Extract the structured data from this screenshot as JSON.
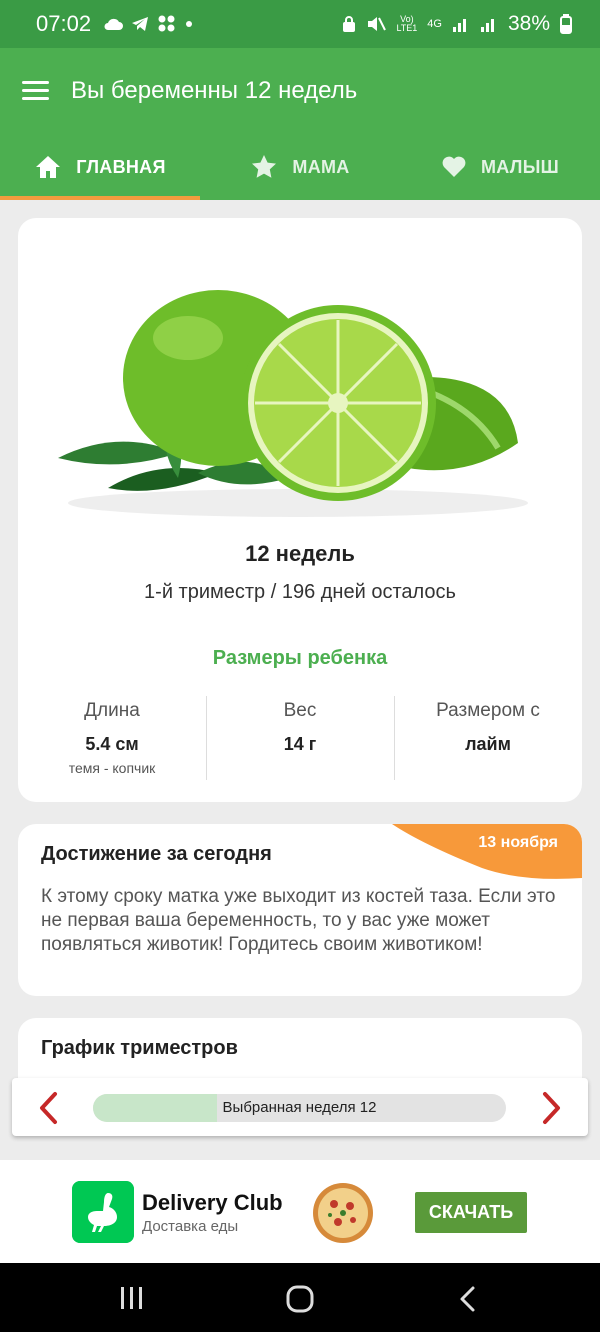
{
  "status": {
    "time": "07:02",
    "network": "4G",
    "battery": "38%"
  },
  "appbar": {
    "title": "Вы беременны 12 недель"
  },
  "tabs": [
    {
      "label": "ГЛАВНАЯ",
      "icon": "home-icon",
      "active": true
    },
    {
      "label": "МАМА",
      "icon": "star-icon",
      "active": false
    },
    {
      "label": "МАЛЫШ",
      "icon": "heart-icon",
      "active": false
    }
  ],
  "main": {
    "image": "lime-image",
    "week_title": "12 недель",
    "trimester": "1-й триместр / 196 дней осталось",
    "sizes_title": "Размеры ребенка",
    "metrics": [
      {
        "label": "Длина",
        "value": "5.4 см",
        "sub": "темя - копчик"
      },
      {
        "label": "Вес",
        "value": "14 г",
        "sub": ""
      },
      {
        "label": "Размером с",
        "value": "лайм",
        "sub": ""
      }
    ]
  },
  "achievement": {
    "title": "Достижение за сегодня",
    "date": "13 ноября",
    "text": "К этому сроку матка уже выходит из костей таза. Если это не первая ваша беременность, то у вас уже может появляться животик! Гордитесь своим животиком!"
  },
  "chart": {
    "title": "График триместров"
  },
  "week_selector": {
    "label": "Выбранная неделя 12",
    "progress_fraction": 0.3
  },
  "ad": {
    "brand": "Delivery Club",
    "subtitle": "Доставка еды",
    "button": "СКАЧАТЬ"
  },
  "colors": {
    "status_bar": "#3a9b45",
    "app_bar": "#4caf50",
    "tab_indicator": "#f39c3e",
    "accent_green": "#4caf50",
    "ribbon": "#f7993a",
    "arrow_red": "#c62828",
    "ad_button": "#5a9a3a"
  }
}
